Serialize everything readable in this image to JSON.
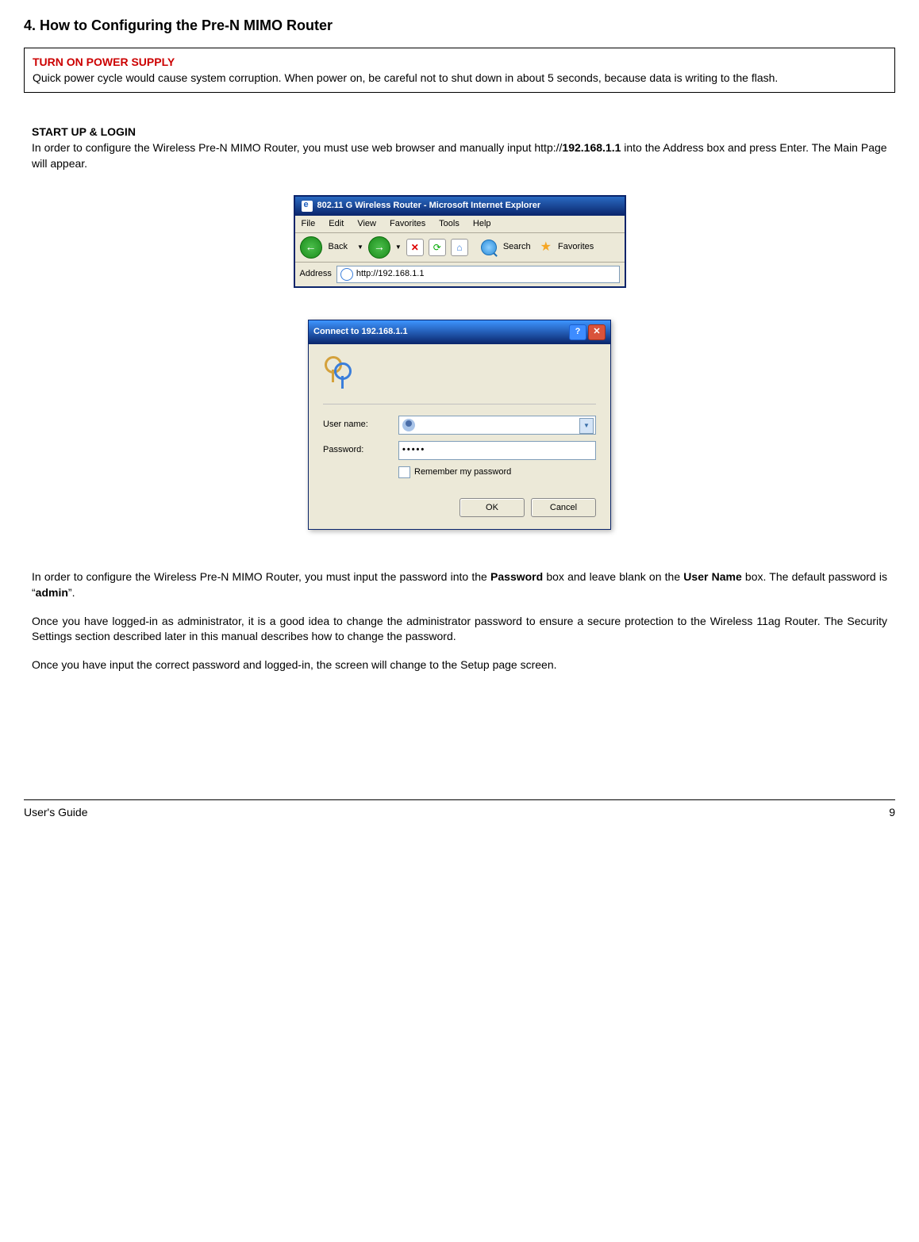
{
  "section_title": "4. How to Configuring the Pre-N MIMO Router",
  "warning": {
    "title": "TURN ON POWER SUPPLY",
    "text": "Quick power cycle would cause system corruption. When power on, be careful not to shut down in about 5 seconds, because data is writing to the flash."
  },
  "startup": {
    "title": "START UP & LOGIN",
    "text_prefix": "In order to configure the Wireless Pre-N MIMO Router, you must use web browser and manually input http://",
    "text_bold_url": "192.168.1.1",
    "text_suffix": " into the Address box and press Enter. The Main Page will appear."
  },
  "browser": {
    "title": "802.11  G Wireless Router - Microsoft Internet Explorer",
    "menu": {
      "file": "File",
      "edit": "Edit",
      "view": "View",
      "favorites": "Favorites",
      "tools": "Tools",
      "help": "Help"
    },
    "toolbar": {
      "back": "Back",
      "search": "Search",
      "favorites_btn": "Favorites"
    },
    "address_label": "Address",
    "address_value": "http://192.168.1.1"
  },
  "dialog": {
    "title": "Connect to 192.168.1.1",
    "username_label": "User name:",
    "password_label": "Password:",
    "password_dots": "•••••",
    "remember": "Remember my password",
    "ok": "OK",
    "cancel": "Cancel"
  },
  "para1": {
    "p1": "In order to configure the Wireless Pre-N MIMO Router, you must input the password into the ",
    "p1b1": "Password",
    "p2": " box and leave blank on the ",
    "p2b2": "User Name",
    "p3": " box. The default password is “",
    "p3b3": "admin",
    "p4": "”."
  },
  "para2": "Once you have logged-in as administrator, it is a good idea to change the administrator password to ensure a secure protection to the Wireless 11ag Router. The Security Settings section described later in this manual describes how to change the password.",
  "para3": "Once you have input the correct password and logged-in, the screen will change to the Setup page screen.",
  "footer": {
    "left": "User's Guide",
    "right": "9"
  }
}
